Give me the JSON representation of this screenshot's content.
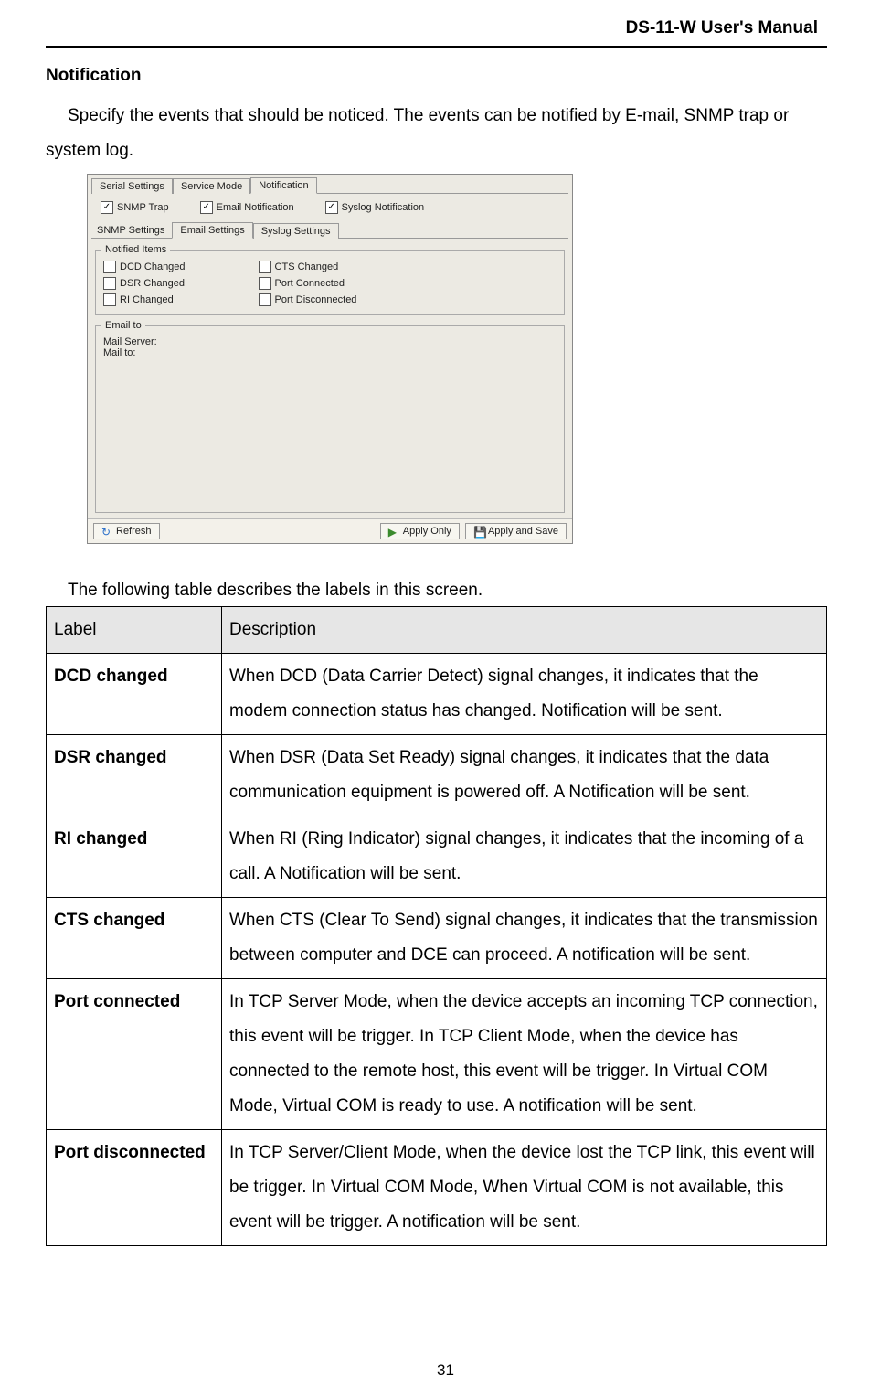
{
  "header": {
    "title": "DS-11-W User's Manual"
  },
  "section": {
    "title": "Notification",
    "intro": "Specify the events that should be noticed.    The events can be notified by E-mail, SNMP trap or system log."
  },
  "screenshot": {
    "top_tabs": [
      "Serial Settings",
      "Service Mode",
      "Notification"
    ],
    "top_active": 2,
    "checks": [
      {
        "label": "SNMP Trap",
        "checked": true
      },
      {
        "label": "Email Notification",
        "checked": true
      },
      {
        "label": "Syslog Notification",
        "checked": true
      }
    ],
    "sub_label": "SNMP Settings",
    "sub_tabs": [
      "Email Settings",
      "Syslog Settings"
    ],
    "sub_active": 0,
    "fieldset_title": "Notified Items",
    "left_items": [
      {
        "label": "DCD Changed",
        "checked": false
      },
      {
        "label": "DSR Changed",
        "checked": false
      },
      {
        "label": "RI Changed",
        "checked": false
      }
    ],
    "right_items": [
      {
        "label": "CTS Changed",
        "checked": false
      },
      {
        "label": "Port Connected",
        "checked": false
      },
      {
        "label": "Port Disconnected",
        "checked": false
      }
    ],
    "email_group": "Email to",
    "email_labels": [
      "Mail Server:",
      "Mail to:"
    ],
    "buttons": {
      "refresh": "Refresh",
      "apply_only": "Apply Only",
      "apply_save": "Apply and Save"
    }
  },
  "table_intro": "The following table describes the labels in this screen.",
  "table": {
    "head": {
      "label": "Label",
      "desc": "Description"
    },
    "rows": [
      {
        "label": "DCD changed",
        "desc": "When DCD (Data Carrier Detect) signal changes, it indicates that the modem connection status has changed.    Notification will be sent."
      },
      {
        "label": "DSR changed",
        "desc": "When DSR (Data Set Ready) signal changes, it indicates that the data communication equipment is powered off.    A Notification will be sent."
      },
      {
        "label": "RI changed",
        "desc": "When RI (Ring Indicator) signal changes, it indicates that the incoming of a call.    A Notification will be sent."
      },
      {
        "label": "CTS changed",
        "desc": "When CTS (Clear To Send) signal changes, it indicates that the transmission between computer and DCE can proceed.    A notification will be sent."
      },
      {
        "label": "Port connected",
        "desc": "In TCP Server Mode, when the device accepts an incoming TCP connection, this event will be trigger.    In TCP Client Mode, when the device has connected to the remote host, this event will be trigger.    In Virtual COM Mode, Virtual COM is ready to use.    A notification will be sent."
      },
      {
        "label": "Port disconnected",
        "desc": "In TCP Server/Client Mode, when the device lost the TCP link, this event will be trigger.    In Virtual COM Mode, When Virtual COM is not available, this event will be trigger.    A notification will be sent."
      }
    ]
  },
  "page_number": "31"
}
